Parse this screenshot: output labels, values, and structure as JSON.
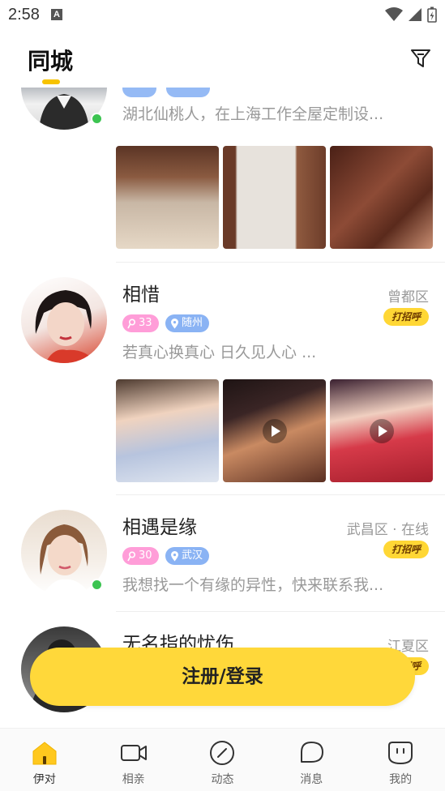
{
  "status_bar": {
    "time": "2:58",
    "notification_letter": "A"
  },
  "header": {
    "title": "同城"
  },
  "feed": [
    {
      "name": "",
      "bio": "湖北仙桃人，在上海工作全屋定制设...",
      "online": true,
      "photos": [
        {
          "colors": [
            "#7a4a35",
            "#c9a98a",
            "#e9dbc7"
          ],
          "video": false
        },
        {
          "colors": [
            "#6a3a28",
            "#e5e0da",
            "#b89478"
          ],
          "video": false
        },
        {
          "colors": [
            "#5a2a1c",
            "#8d4b36",
            "#3e1c12"
          ],
          "video": false
        }
      ]
    },
    {
      "name": "相惜",
      "district": "曾都区",
      "greet": "打招呼",
      "age": "33",
      "city": "随州",
      "bio": "若真心换真心  日久见人心  ...",
      "online": false,
      "photos": [
        {
          "colors": [
            "#f1d7c6",
            "#a9b8d6",
            "#dfe5ef"
          ],
          "video": false
        },
        {
          "colors": [
            "#2a1a1a",
            "#c0774c",
            "#6b3a2a"
          ],
          "video": true
        },
        {
          "colors": [
            "#d93a4a",
            "#2b1b25",
            "#f2cfc2"
          ],
          "video": true
        }
      ]
    },
    {
      "name": "相遇是缘",
      "district": "武昌区 · 在线",
      "greet": "打招呼",
      "age": "30",
      "city": "武汉",
      "bio": "我想找一个有缘的异性，快来联系我...",
      "online": true,
      "photos": []
    },
    {
      "name": "无名指的忧伤",
      "district": "江夏区",
      "greet": "打招呼",
      "online": false,
      "photos": []
    }
  ],
  "register_button": "注册/登录",
  "bottom_nav": [
    {
      "label": "伊对",
      "icon": "home-icon",
      "active": true
    },
    {
      "label": "相亲",
      "icon": "video-camera-icon",
      "active": false
    },
    {
      "label": "动态",
      "icon": "compass-icon",
      "active": false
    },
    {
      "label": "消息",
      "icon": "chat-bubble-icon",
      "active": false
    },
    {
      "label": "我的",
      "icon": "profile-face-icon",
      "active": false
    }
  ],
  "colors": {
    "accent": "#ffd83a",
    "online": "#3cc451",
    "age_tag": "#ff9dd8",
    "location_tag": "#8ab3f4"
  }
}
